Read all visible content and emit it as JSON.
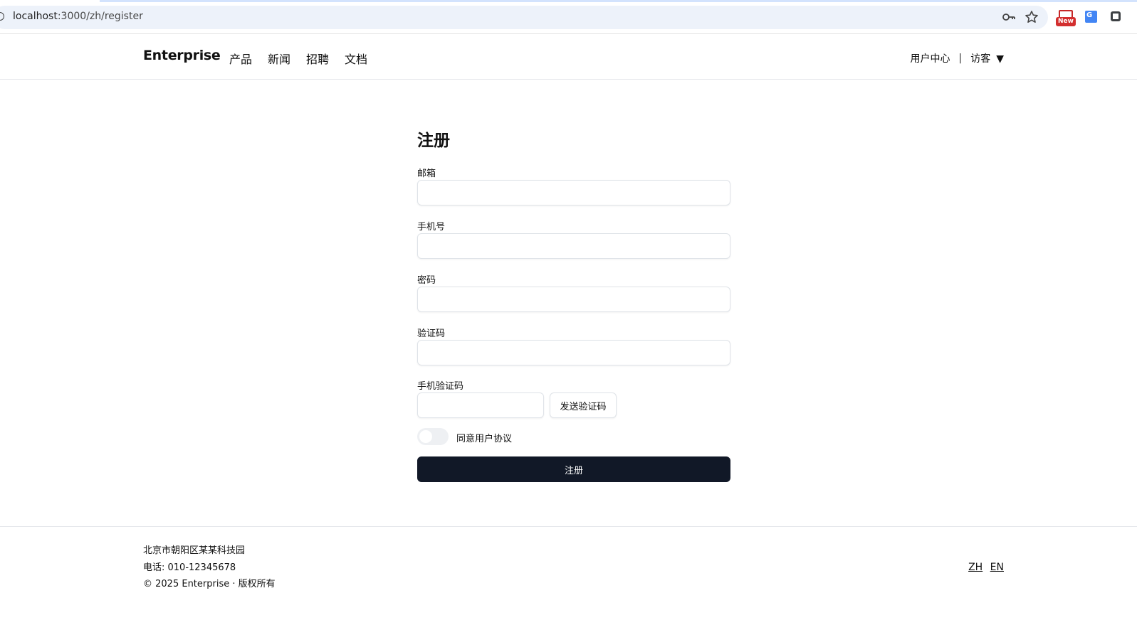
{
  "browser": {
    "url_host": "localhost",
    "url_rest": ":3000/zh/register",
    "ext_badge_text": "New"
  },
  "header": {
    "brand": "Enterprise",
    "nav": [
      "产品",
      "新闻",
      "招聘",
      "文档"
    ],
    "user_center": "用户中心",
    "separator": "|",
    "guest": "访客",
    "guest_caret": "▼"
  },
  "form": {
    "title": "注册",
    "email_label": "邮箱",
    "email_value": "",
    "phone_label": "手机号",
    "phone_value": "",
    "password_label": "密码",
    "password_value": "",
    "captcha_label": "验证码",
    "captcha_value": "",
    "sms_label": "手机验证码",
    "sms_value": "",
    "send_code_label": "发送验证码",
    "agree_label": "同意用户协议",
    "agree_checked": false,
    "submit_label": "注册"
  },
  "footer": {
    "address": "北京市朝阳区某某科技园",
    "phone": "电话: 010-12345678",
    "copyright": "© 2025 Enterprise · 版权所有",
    "lang_zh": "ZH",
    "lang_en": "EN"
  },
  "colors": {
    "primary_button": "#111827",
    "border": "#e5e7eb",
    "omnibox": "#edf2fa"
  }
}
